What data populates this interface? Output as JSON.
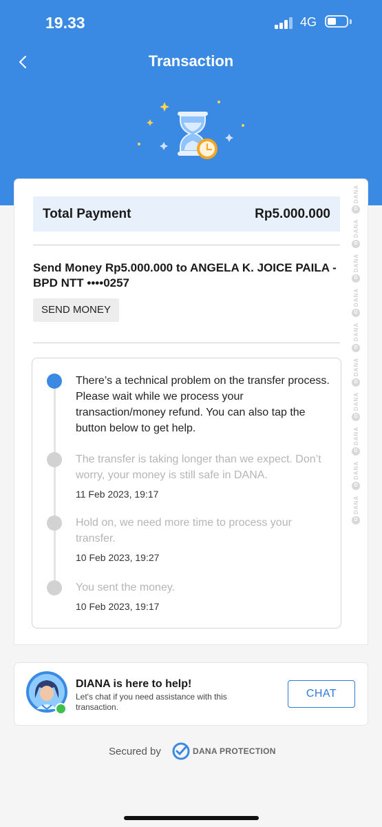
{
  "status_bar": {
    "time": "19.33",
    "network": "4G"
  },
  "header": {
    "title": "Transaction"
  },
  "receipt": {
    "total_label": "Total Payment",
    "total_amount": "Rp5.000.000",
    "description_line1": "Send Money Rp5.000.000 to ANGELA K. JOICE PAILA -",
    "description_line2": "BPD NTT ••••0257",
    "category_badge": "SEND MONEY",
    "watermark_text": "DANA"
  },
  "timeline": [
    {
      "text": "There’s a technical problem on the transfer process. Please wait while we process your transaction/money refund. You can also tap the button below to get help.",
      "date": ""
    },
    {
      "text": "The transfer is taking longer than we expect. Don’t worry, your money is still safe in DANA.",
      "date": "11 Feb 2023, 19:17"
    },
    {
      "text": "Hold on, we need more time to process your transfer.",
      "date": "10 Feb 2023, 19:27"
    },
    {
      "text": "You sent the money.",
      "date": "10 Feb 2023, 19:17"
    }
  ],
  "help": {
    "title": "DIANA is here to help!",
    "subtitle": "Let's chat if you need assistance with this transaction.",
    "chat_button": "CHAT"
  },
  "footer": {
    "secured_by": "Secured by",
    "protection": "DANA PROTECTION"
  },
  "colors": {
    "brand_blue": "#3a8ae3",
    "accent_blue": "#2f7ad6",
    "online_green": "#3fbf4d"
  },
  "icons": {
    "back": "chevron-left-icon",
    "status": "hourglass-clock-icon",
    "shield": "dana-protection-icon"
  }
}
